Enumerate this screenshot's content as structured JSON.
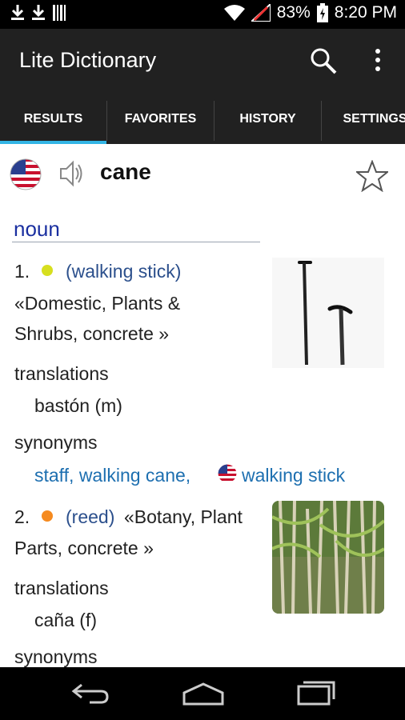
{
  "status": {
    "battery": "83%",
    "time": "8:20 PM"
  },
  "app": {
    "title": "Lite Dictionary",
    "icons": [
      "search-icon",
      "more-vert-icon"
    ]
  },
  "tabs": [
    {
      "label": "RESULTS"
    },
    {
      "label": "FAVORITES"
    },
    {
      "label": "HISTORY"
    },
    {
      "label": "SETTINGS"
    }
  ],
  "entry": {
    "word": "cane",
    "part_of_speech": "noun",
    "senses": [
      {
        "number": "1.",
        "dot_color": "#d7df1f",
        "definition": "(walking stick)",
        "context_line1": "«Domestic, Plants &",
        "context_line2": "Shrubs, concrete »",
        "translations_label": "translations",
        "translation": "bastón (m)",
        "synonyms_label": "synonyms",
        "synonyms_part1": "staff, walking cane,",
        "synonyms_part2": "walking stick"
      },
      {
        "number": "2.",
        "dot_color": "#f58a1f",
        "definition": "(reed)",
        "context_line1": "«Botany, Plant",
        "context_line2": "Parts, concrete »",
        "translations_label": "translations",
        "translation": "caña (f)",
        "synonyms_label": "synonyms"
      }
    ]
  },
  "colors": {
    "accent": "#33b5e5",
    "bar": "#212121"
  }
}
